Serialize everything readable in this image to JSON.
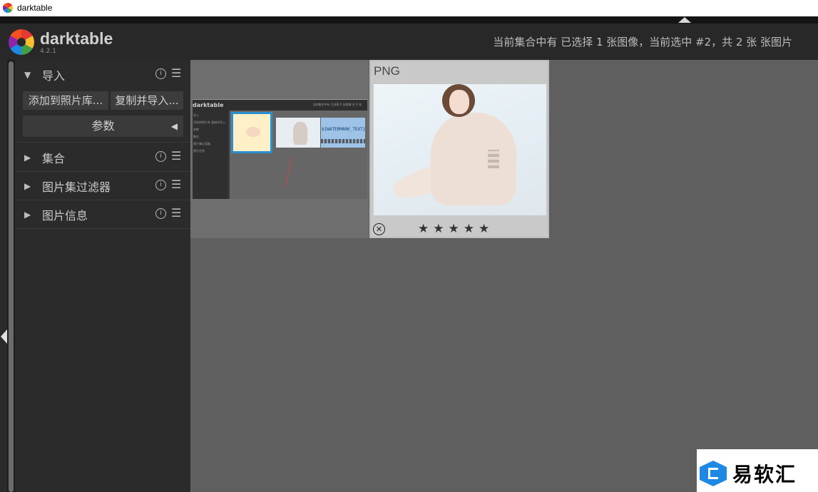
{
  "window": {
    "title": "darktable"
  },
  "header": {
    "brand": "darktable",
    "version": "4.2.1",
    "status": "当前集合中有 已选择 1 张图像，当前选中 #2，共 2 张 张图片"
  },
  "left_panel": {
    "sections": [
      {
        "label": "导入",
        "expanded": true
      },
      {
        "label": "集合",
        "expanded": false
      },
      {
        "label": "图片集过滤器",
        "expanded": false
      },
      {
        "label": "图片信息",
        "expanded": false
      }
    ],
    "import": {
      "add_to_library": "添加到照片库...",
      "copy_and_import": "复制并导入...",
      "parameters": "参数"
    },
    "icons": {
      "info": "info-icon",
      "menu": "hamburger-menu-icon",
      "expand": "triangle-right-icon",
      "collapse": "triangle-down-icon"
    }
  },
  "lighttable": {
    "thumb1": {
      "mini": {
        "brand": "darktable",
        "status": "当前集合中有 已选择 0 张图像 共 3 张",
        "side_lines": [
          "导入",
          "添加到照片库  复制并导入",
          "参数",
          "集合",
          "图片集过滤器",
          "图片信息"
        ],
        "watermark_text": "${WATERMARK_TEXT}"
      }
    },
    "thumb2": {
      "extension": "PNG",
      "rating_stars": "★★★★★",
      "reject_symbol": "✕"
    }
  },
  "watermark": {
    "text": "易软汇"
  },
  "colors": {
    "accent": "#2a8fd0",
    "background": "#5f5f5f",
    "panel": "#2b2b2b"
  }
}
